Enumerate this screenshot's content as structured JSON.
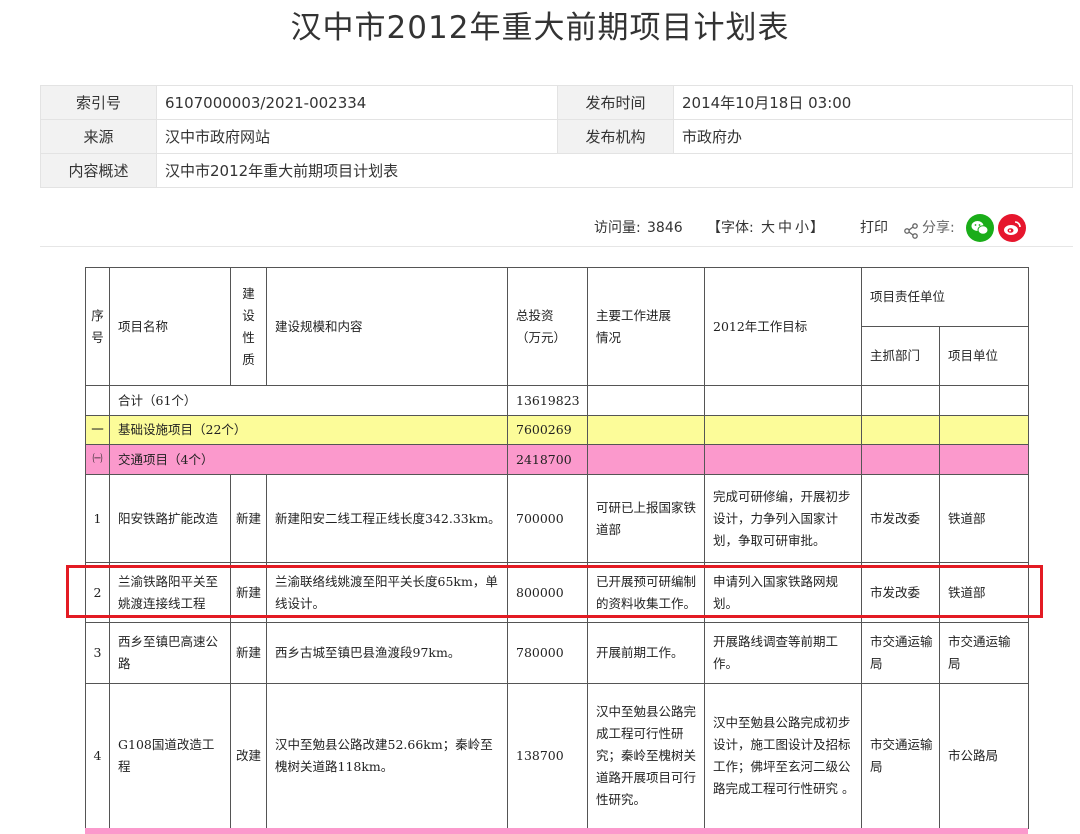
{
  "title": "汉中市2012年重大前期项目计划表",
  "meta": {
    "index_label": "索引号",
    "index_value": "6107000003/2021-002334",
    "pubtime_label": "发布时间",
    "pubtime_value": "2014年10月18日 03:00",
    "source_label": "来源",
    "source_value": "汉中市政府网站",
    "org_label": "发布机构",
    "org_value": "市政府办",
    "summary_label": "内容概述",
    "summary_value": "汉中市2012年重大前期项目计划表"
  },
  "toolbar": {
    "visits_label": "访问量:",
    "visits_value": "3846",
    "font_prefix": "【字体:",
    "font_large": "大",
    "font_medium": "中",
    "font_small": "小",
    "font_suffix": "】",
    "print_label": "打印",
    "share_label": "分享:",
    "wechat_color": "#1aad19",
    "weibo_color": "#e6162d"
  },
  "table": {
    "headers": {
      "seq": "序号",
      "name": "项目名称",
      "nature": "建设性质",
      "scale": "建设规模和内容",
      "invest": "总投资（万元）",
      "progress": "主要工作进展情况",
      "goal": "2012年工作目标",
      "resp": "项目责任单位",
      "dept": "主抓部门",
      "unit": "项目单位"
    },
    "total": {
      "name": "合计（61个）",
      "invest": "13619823"
    },
    "group1": {
      "seq": "一",
      "name": "基础设施项目（22个）",
      "invest": "7600269",
      "color": "#fcfc99"
    },
    "group2": {
      "seq": "㈠",
      "name": "交通项目（4个）",
      "invest": "2418700",
      "color": "#fb99cc"
    },
    "rows": [
      {
        "seq": "1",
        "name": "阳安铁路扩能改造",
        "nature": "新建",
        "scale": "新建阳安二线工程正线长度342.33km。",
        "invest": "700000",
        "progress": "可研已上报国家铁道部",
        "goal": "完成可研修编，开展初步设计，力争列入国家计划，争取可研审批。",
        "dept": "市发改委",
        "unit": "铁道部"
      },
      {
        "seq": "2",
        "name": "兰渝铁路阳平关至姚渡连接线工程",
        "nature": "新建",
        "scale": "兰渝联络线姚渡至阳平关长度65km，单线设计。",
        "invest": "800000",
        "progress": "已开展预可研编制的资料收集工作。",
        "goal": "申请列入国家铁路网规划。",
        "dept": "市发改委",
        "unit": "铁道部"
      },
      {
        "seq": "3",
        "name": "西乡至镇巴高速公路",
        "nature": "新建",
        "scale": "西乡古城至镇巴县渔渡段97km。",
        "invest": "780000",
        "progress": "开展前期工作。",
        "goal": "开展路线调查等前期工作。",
        "dept": "市交通运输局",
        "unit": "市交通运输局"
      },
      {
        "seq": "4",
        "name": "G108国道改造工程",
        "nature": "改建",
        "scale": "汉中至勉县公路改建52.66km；秦岭至槐树关道路118km。",
        "invest": "138700",
        "progress": "汉中至勉县公路完成工程可行性研究；秦岭至槐树关道路开展项目可行性研究。",
        "goal": "汉中至勉县公路完成初步设计，施工图设计及招标工作；佛坪至玄河二级公路完成工程可行性研究 。",
        "dept": "市交通运输局",
        "unit": "市公路局"
      }
    ]
  },
  "highlight_color": "#e31b23"
}
